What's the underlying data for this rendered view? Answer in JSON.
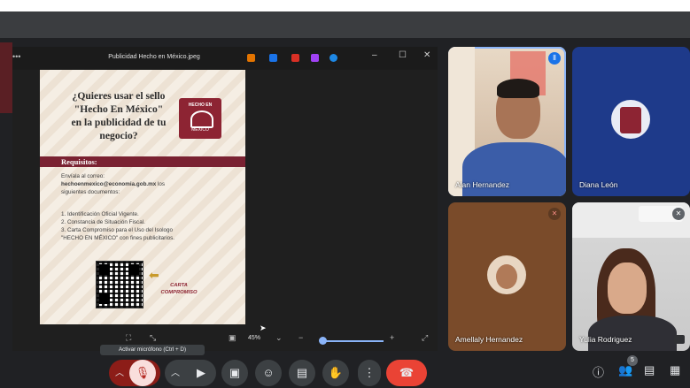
{
  "window": {
    "filename": "Publicidad Hecho en México.jpeg"
  },
  "flyer": {
    "headline_lines": [
      "¿Quieres usar el sello",
      "\"Hecho En México\"",
      "en la publicidad de tu",
      "negocio?"
    ],
    "seal_top": "HECHO EN",
    "seal_bottom": "MÉXICO",
    "requirements_label": "Requisitos:",
    "send_to": "Envíala al correo:",
    "email": "hechoenmexico@economia.gob.mx",
    "email_suffix": "los",
    "docs_intro": "siguientes documentos:",
    "items": [
      "1. Identificación Oficial Vigente.",
      "2. Constancia de Situación Fiscal.",
      "3. Carta Compromiso para el Uso del Isologo",
      "\"HECHO EN MÉXICO\" con fines publicitarios."
    ],
    "carta_lines": [
      "CARTA",
      "COMPROMISO"
    ]
  },
  "viewer": {
    "zoom": "45%"
  },
  "participants": {
    "alan": "Alan Hernandez",
    "diana": "Diana León",
    "amellaly": "Amellaly Hernandez",
    "yulia": "Yulia Rodriguez"
  },
  "tooltip": "Activar micrófono (Ctrl + D)",
  "people_count": "5",
  "colors": {
    "meet_bg": "#202124",
    "accent_blue": "#8ab4f8",
    "leave_red": "#ea4335",
    "flyer_maroon": "#7a2232"
  }
}
